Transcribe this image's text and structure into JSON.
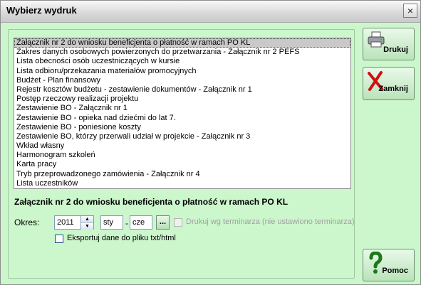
{
  "window": {
    "title": "Wybierz wydruk",
    "close_symbol": "×"
  },
  "report_list": {
    "items": [
      "Załącznik nr 2 do wniosku beneficjenta o płatność w ramach PO KL",
      "Zakres danych osobowych powierzonych do przetwarzania - Załącznik nr 2 PEFS",
      "Lista obecności osób uczestniczących w kursie",
      "Lista odbioru/przekazania materiałów promocyjnych",
      "Budżet - Plan finansowy",
      "Rejestr kosztów budżetu - zestawienie dokumentów - Załącznik nr 1",
      "Postęp rzeczowy realizacji projektu",
      "Zestawienie BO - Załącznik nr 1",
      "Zestawienie BO - opieka nad dziećmi do lat 7.",
      "Zestawienie BO - poniesione koszty",
      "Zestawienie BO, którzy przerwali udział w projekcie - Załącznik nr 3",
      "Wkład własny",
      "Harmonogram szkoleń",
      "Karta pracy",
      "Tryb przeprowadzonego zamówienia - Załącznik nr 4",
      "Lista uczestników"
    ],
    "selected_index": 0
  },
  "selected_report_title": "Załącznik nr 2 do wniosku beneficjenta o płatność w ramach PO KL",
  "period": {
    "label": "Okres:",
    "year": "2011",
    "from_month": "sty",
    "dash": "-",
    "to_month": "cze",
    "ellipsis_label": "..."
  },
  "options": {
    "schedule_label": "Drukuj wg terminarza (nie ustawiono terminarza)",
    "schedule_checked": false,
    "schedule_enabled": false,
    "export_label": "Eksportuj dane do pliku txt/html",
    "export_checked": false
  },
  "buttons": {
    "print_label": "Drukuj",
    "close_label": "Zamknij",
    "help_label": "Pomoc"
  },
  "icons": {
    "print": "printer-icon",
    "close": "red-x-icon",
    "help": "question-mark-icon"
  }
}
